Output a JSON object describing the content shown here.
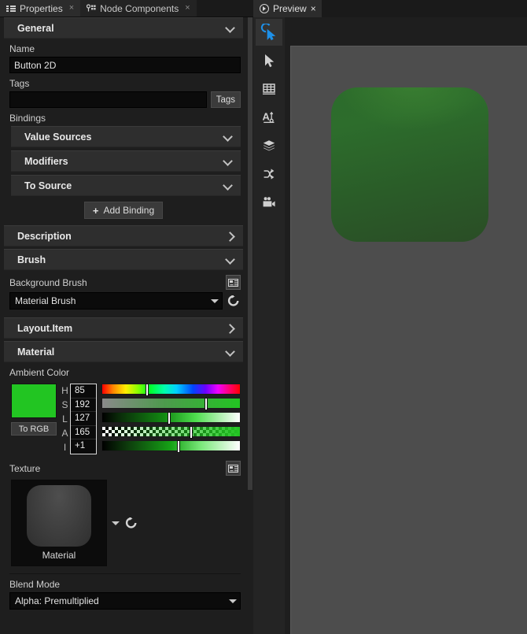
{
  "left_panel": {
    "tabs": [
      {
        "label": "Properties",
        "icon": "list-icon",
        "active": true,
        "close": "×"
      },
      {
        "label": "Node Components",
        "icon": "node-components-icon",
        "active": false,
        "close": "×"
      }
    ],
    "groups": {
      "general": "General",
      "description": "Description",
      "brush": "Brush",
      "layout_item": "Layout.Item",
      "material": "Material",
      "value_sources": "Value Sources",
      "modifiers": "Modifiers",
      "to_source": "To Source"
    },
    "general": {
      "name_label": "Name",
      "name_value": "Button 2D",
      "tags_label": "Tags",
      "tags_value": "",
      "tags_button": "Tags",
      "bindings_label": "Bindings",
      "add_binding": "Add Binding",
      "add_binding_plus": "+"
    },
    "brush": {
      "background_brush_label": "Background Brush",
      "background_brush_value": "Material Brush"
    },
    "material": {
      "ambient_color_label": "Ambient Color",
      "to_rgb_button": "To RGB",
      "channels": [
        {
          "letter": "H",
          "value": "85",
          "knob_pct": 31.5,
          "type": "hue"
        },
        {
          "letter": "S",
          "value": "192",
          "knob_pct": 74.5,
          "type": "saturation"
        },
        {
          "letter": "L",
          "value": "127",
          "knob_pct": 47.5,
          "type": "lightness"
        },
        {
          "letter": "A",
          "value": "165",
          "knob_pct": 63.5,
          "type": "alpha"
        },
        {
          "letter": "I",
          "value": "+1",
          "knob_pct": 54.0,
          "type": "intensity"
        }
      ],
      "swatch_color": "#22c522",
      "texture_label": "Texture",
      "texture_name": "Material",
      "blend_mode_label": "Blend Mode",
      "blend_mode_value": "Alpha: Premultiplied"
    }
  },
  "right_panel": {
    "tab": {
      "label": "Preview",
      "icon": "play-circle-icon",
      "close": "×"
    },
    "tools": [
      {
        "name": "pointer-select-tool",
        "active": true
      },
      {
        "name": "arrow-tool",
        "active": false
      },
      {
        "name": "grid-tool",
        "active": false
      },
      {
        "name": "text-tool",
        "active": false
      },
      {
        "name": "layers-tool",
        "active": false
      },
      {
        "name": "node-graph-tool",
        "active": false
      },
      {
        "name": "camera-tool",
        "active": false
      }
    ],
    "canvas": {
      "background_color": "#4d4d4d",
      "object_color": "#2c6b2b"
    }
  }
}
